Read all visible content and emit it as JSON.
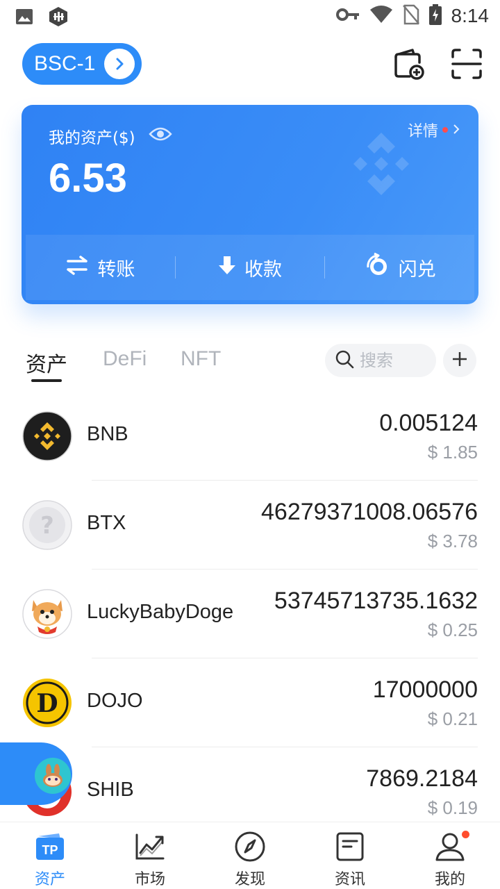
{
  "status_bar": {
    "time": "8:14",
    "icons": [
      "image-icon",
      "app-notification-icon",
      "vpn-key-icon",
      "wifi-icon",
      "no-sim-icon",
      "battery-charging-icon"
    ]
  },
  "header": {
    "network_label": "BSC-1",
    "icons": [
      "add-wallet-icon",
      "scan-icon"
    ]
  },
  "asset_card": {
    "label": "我的资产($)",
    "amount": "6.53",
    "detail_label": "详情",
    "actions": [
      {
        "label": "转账",
        "icon": "transfer-icon"
      },
      {
        "label": "收款",
        "icon": "receive-icon"
      },
      {
        "label": "闪兑",
        "icon": "swap-icon"
      }
    ]
  },
  "tabs": [
    {
      "label": "资产",
      "active": true
    },
    {
      "label": "DeFi",
      "active": false
    },
    {
      "label": "NFT",
      "active": false
    }
  ],
  "search": {
    "placeholder": "搜索"
  },
  "tokens": [
    {
      "name": "BNB",
      "balance": "0.005124",
      "value": "$ 1.85",
      "icon": "bnb-icon"
    },
    {
      "name": "BTX",
      "balance": "46279371008.06576",
      "value": "$ 3.78",
      "icon": "unknown-token-icon"
    },
    {
      "name": "LuckyBabyDoge",
      "balance": "53745713735.1632",
      "value": "$ 0.25",
      "icon": "doge-icon"
    },
    {
      "name": "DOJO",
      "balance": "17000000",
      "value": "$ 0.21",
      "icon": "dojo-icon"
    },
    {
      "name": "SHIB",
      "balance": "7869.2184",
      "value": "$ 0.19",
      "icon": "shib-icon"
    }
  ],
  "bottom_nav": [
    {
      "label": "资产",
      "icon": "tp-wallet-icon",
      "active": true
    },
    {
      "label": "市场",
      "icon": "market-chart-icon",
      "active": false
    },
    {
      "label": "发现",
      "icon": "compass-icon",
      "active": false
    },
    {
      "label": "资讯",
      "icon": "news-icon",
      "active": false
    },
    {
      "label": "我的",
      "icon": "profile-icon",
      "active": false
    }
  ],
  "colors": {
    "accent": "#2d8cf8",
    "card_gradient_start": "#2f82f4",
    "card_gradient_end": "#4a9af9",
    "muted_text": "#9a9ea5",
    "notification_dot": "#ff4d4f"
  }
}
